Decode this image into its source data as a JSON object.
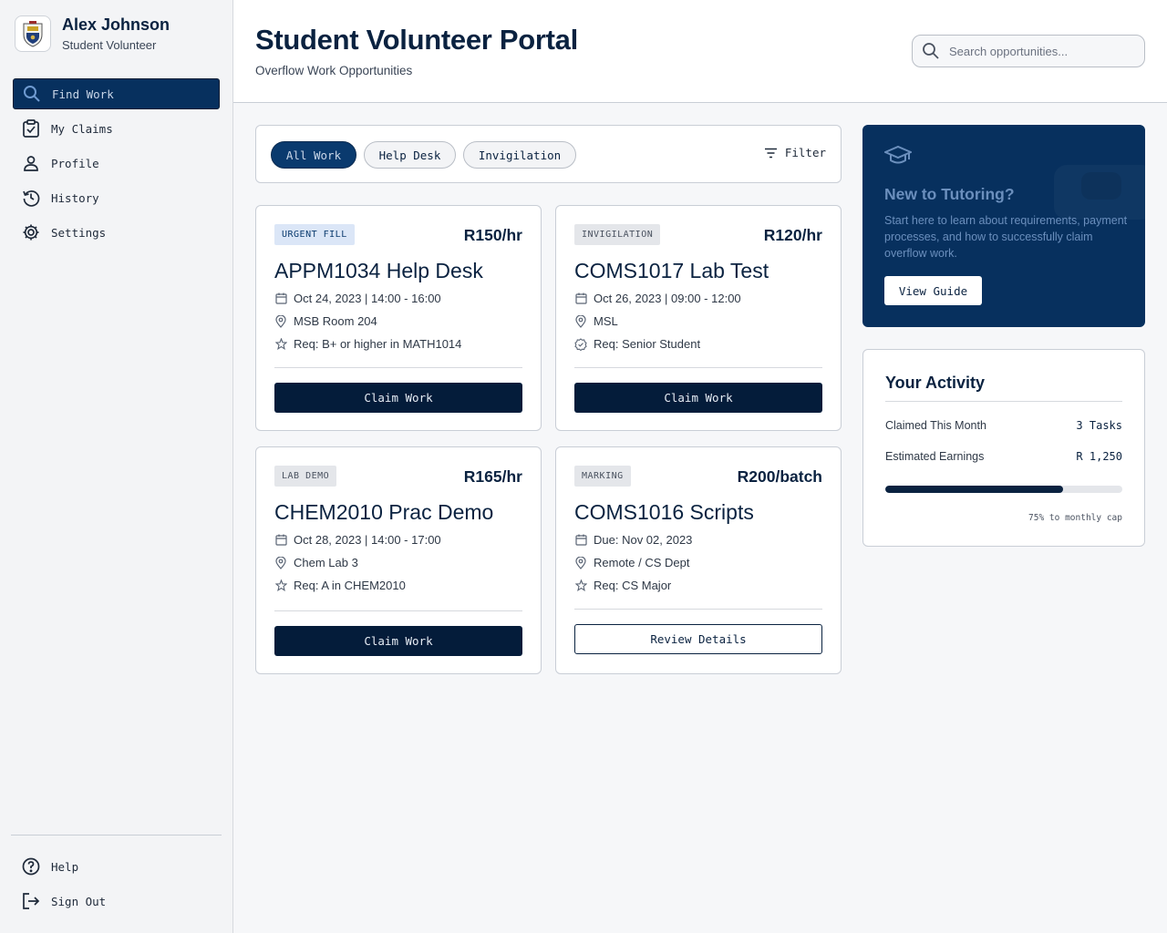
{
  "user": {
    "name": "Alex Johnson",
    "role": "Student Volunteer"
  },
  "nav": {
    "items": [
      {
        "label": "Find Work",
        "icon": "search-icon",
        "active": true
      },
      {
        "label": "My Claims",
        "icon": "clipboard-check-icon"
      },
      {
        "label": "Profile",
        "icon": "user-icon"
      },
      {
        "label": "History",
        "icon": "history-icon"
      },
      {
        "label": "Settings",
        "icon": "gear-icon"
      }
    ],
    "bottom": [
      {
        "label": "Help",
        "icon": "help-circle-icon"
      },
      {
        "label": "Sign Out",
        "icon": "sign-out-icon"
      }
    ]
  },
  "header": {
    "title": "Student Volunteer Portal",
    "subtitle": "Overflow Work Opportunities",
    "search_placeholder": "Search opportunities..."
  },
  "filters": {
    "chips": [
      "All Work",
      "Help Desk",
      "Invigilation"
    ],
    "active": "All Work",
    "filter_label": "Filter"
  },
  "cards": [
    {
      "badge": "URGENT FILL",
      "badge_style": "blue",
      "rate": "R150/hr",
      "title": "APPM1034 Help Desk",
      "date": "Oct 24, 2023 | 14:00 - 16:00",
      "location": "MSB Room 204",
      "requirement": "Req: B+ or higher in MATH1014",
      "req_icon": "star-icon",
      "button": "Claim Work",
      "button_style": "solid"
    },
    {
      "badge": "INVIGILATION",
      "badge_style": "gray",
      "rate": "R120/hr",
      "title": "COMS1017 Lab Test",
      "date": "Oct 26, 2023 | 09:00 - 12:00",
      "location": "MSL",
      "requirement": "Req: Senior Student",
      "req_icon": "verified-badge-icon",
      "button": "Claim Work",
      "button_style": "solid"
    },
    {
      "badge": "LAB DEMO",
      "badge_style": "gray",
      "rate": "R165/hr",
      "title": "CHEM2010 Prac Demo",
      "date": "Oct 28, 2023 | 14:00 - 17:00",
      "location": "Chem Lab 3",
      "requirement": "Req: A in CHEM2010",
      "req_icon": "star-icon",
      "button": "Claim Work",
      "button_style": "solid"
    },
    {
      "badge": "MARKING",
      "badge_style": "gray",
      "rate": "R200/batch",
      "title": "COMS1016 Scripts",
      "date": "Due: Nov 02, 2023",
      "location": "Remote / CS Dept",
      "requirement": "Req: CS Major",
      "req_icon": "star-icon",
      "button": "Review Details",
      "button_style": "outline"
    }
  ],
  "promo": {
    "title": "New to Tutoring?",
    "text": "Start here to learn about requirements, payment processes, and how to successfully claim overflow work.",
    "button": "View Guide"
  },
  "activity": {
    "title": "Your Activity",
    "rows": [
      {
        "label": "Claimed This Month",
        "value": "3 Tasks"
      },
      {
        "label": "Estimated Earnings",
        "value": "R 1,250"
      }
    ],
    "progress_fraction": 0.75,
    "progress_caption": "75% to monthly cap"
  },
  "colors": {
    "primary": "#07305e",
    "primary_dark": "#041c3a",
    "muted_blue": "#6b8fbd",
    "badge_blue_bg": "#dbe6f7"
  }
}
